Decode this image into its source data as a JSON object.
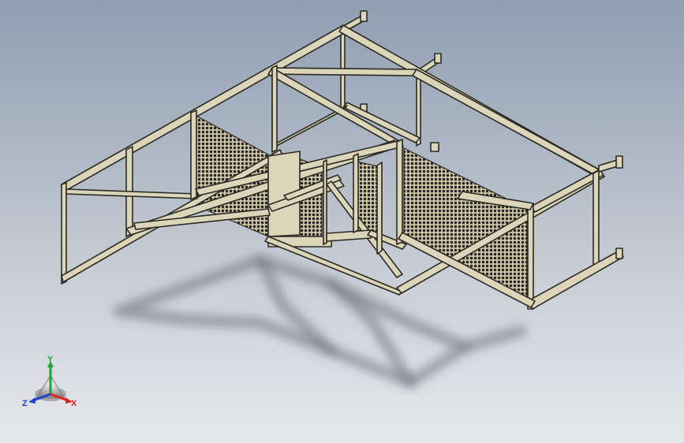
{
  "triad": {
    "y_label": "Y",
    "x_label": "X",
    "z_label": "Z",
    "colors": {
      "x": "#e0261b",
      "y": "#1da336",
      "z": "#1f3fd0"
    }
  },
  "colors": {
    "background_top": "#8f9eb2",
    "background_bottom": "#e7e8eb",
    "frame": "#dbd6b9",
    "edge": "#2b2a22"
  }
}
